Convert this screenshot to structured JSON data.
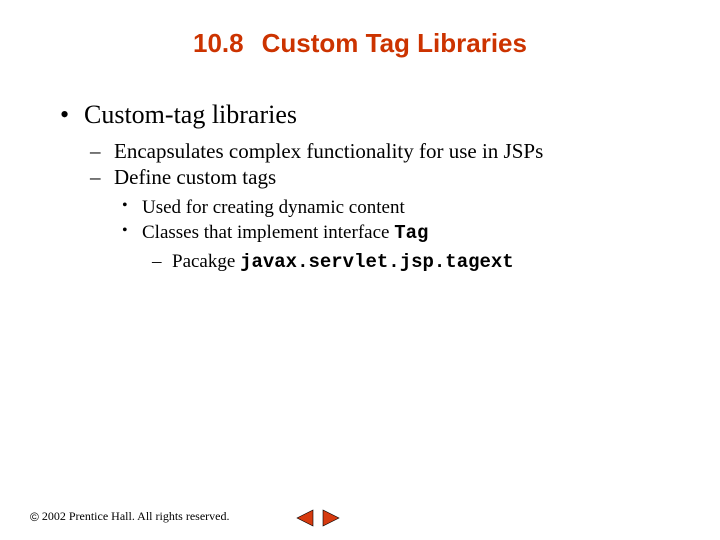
{
  "title": {
    "section_number": "10.8",
    "heading": "Custom Tag Libraries"
  },
  "bullets": {
    "lvl1": "Custom-tag libraries",
    "lvl2a": "Encapsulates complex functionality for use in JSPs",
    "lvl2b": "Define custom tags",
    "lvl3a": "Used for creating dynamic content",
    "lvl3b_prefix": "Classes that implement interface ",
    "lvl3b_code": "Tag",
    "lvl4_prefix": "Pacakge ",
    "lvl4_code": "javax.servlet.jsp.tagext"
  },
  "footer": {
    "copyright_symbol": "©",
    "text": "2002 Prentice Hall. All rights reserved."
  },
  "nav": {
    "prev": "previous",
    "next": "next"
  },
  "colors": {
    "title": "#cc3300",
    "nav_fill": "#d63a0f",
    "nav_stroke": "#000000"
  }
}
